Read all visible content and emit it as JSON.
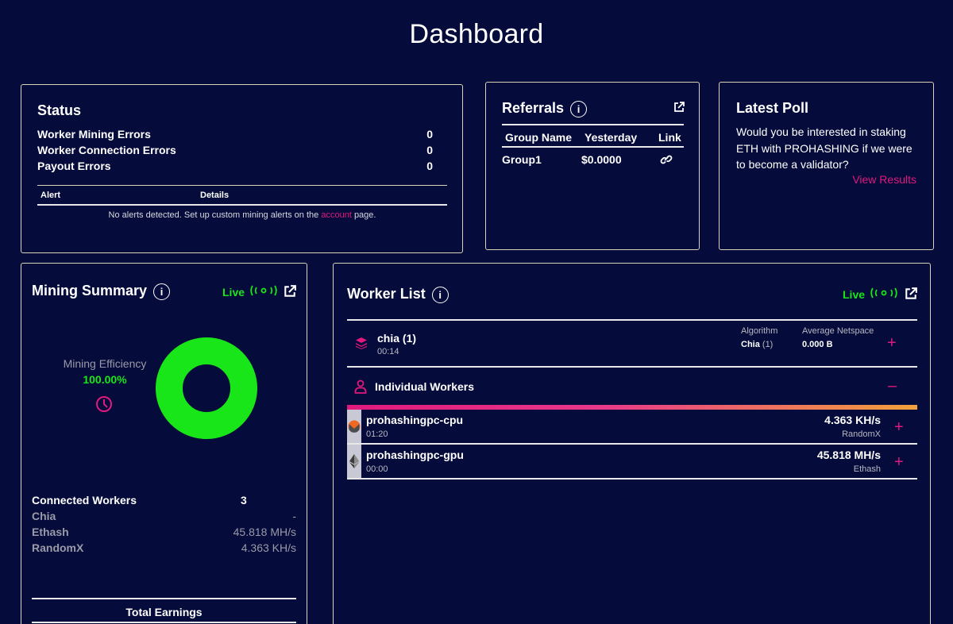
{
  "page": {
    "title": "Dashboard"
  },
  "colors": {
    "background": "#050b3a",
    "accent": "#e0197d",
    "live_green": "#19e619",
    "border": "#d9d3b8"
  },
  "status": {
    "title": "Status",
    "rows": [
      {
        "label": "Worker Mining Errors",
        "value": "0"
      },
      {
        "label": "Worker Connection Errors",
        "value": "0"
      },
      {
        "label": "Payout Errors",
        "value": "0"
      }
    ],
    "alerts_table": {
      "columns": [
        "Alert",
        "Details"
      ],
      "empty_prefix": "No alerts detected. Set up custom mining alerts on the",
      "empty_link": "account",
      "empty_suffix": "page."
    }
  },
  "referrals": {
    "title": "Referrals",
    "info_icon": "i",
    "columns": [
      "Group Name",
      "Yesterday",
      "Link"
    ],
    "rows": [
      {
        "group": "Group1",
        "yesterday": "$0.0000",
        "link_icon": "link-icon"
      }
    ]
  },
  "poll": {
    "title": "Latest Poll",
    "question": "Would you be interested in staking ETH with PROHASHING if we were to become a validator?",
    "link": "View Results"
  },
  "mining_summary": {
    "title": "Mining Summary",
    "info_icon": "i",
    "live_label": "Live",
    "efficiency_label": "Mining Efficiency",
    "efficiency_value": "100.00%",
    "efficiency_fraction": 1.0,
    "connected_workers": {
      "label": "Connected Workers",
      "value": "3"
    },
    "algorithms": [
      {
        "name": "Chia",
        "rate": "-"
      },
      {
        "name": "Ethash",
        "rate": "45.818 MH/s"
      },
      {
        "name": "RandomX",
        "rate": "4.363 KH/s"
      }
    ],
    "total_earnings_label": "Total Earnings"
  },
  "worker_list": {
    "title": "Worker List",
    "info_icon": "i",
    "live_label": "Live",
    "algo_group": {
      "name": "chia (1)",
      "time": "00:14",
      "algorithm_label": "Algorithm",
      "algorithm_value": "Chia",
      "algorithm_count": "(1)",
      "netspace_label": "Average Netspace",
      "netspace_value": "0.000 B",
      "expand": "+"
    },
    "individual": {
      "label": "Individual Workers",
      "collapse": "–"
    },
    "workers": [
      {
        "name": "prohashingpc-cpu",
        "time": "01:20",
        "rate": "4.363 KH/s",
        "algo": "RandomX",
        "coin_icon": "monero-icon",
        "expand": "+"
      },
      {
        "name": "prohashingpc-gpu",
        "time": "00:00",
        "rate": "45.818 MH/s",
        "algo": "Ethash",
        "coin_icon": "ethereum-icon",
        "expand": "+"
      }
    ]
  }
}
